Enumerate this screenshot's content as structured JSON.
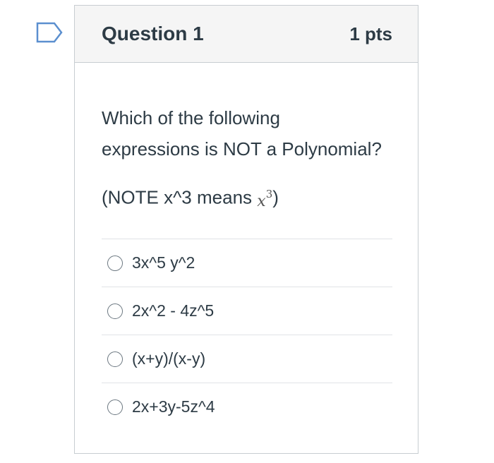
{
  "flag_icon": "flag-outline-icon",
  "question": {
    "title": "Question 1",
    "points": "1 pts",
    "text_line1": "Which of the following",
    "text_line2": "expressions is NOT a Polynomial?",
    "note_prefix": "(NOTE x^3 means ",
    "note_math_base": "x",
    "note_math_exp": "3",
    "note_suffix": ")"
  },
  "answers": [
    {
      "label": "3x^5 y^2"
    },
    {
      "label": "2x^2 - 4z^5"
    },
    {
      "label": "(x+y)/(x-y)"
    },
    {
      "label": "2x+3y-5z^4"
    }
  ],
  "colors": {
    "accent_flag": "#5b8fcf",
    "text": "#2d3b45",
    "header_bg": "#f5f5f5",
    "border": "#c7cdd1"
  }
}
